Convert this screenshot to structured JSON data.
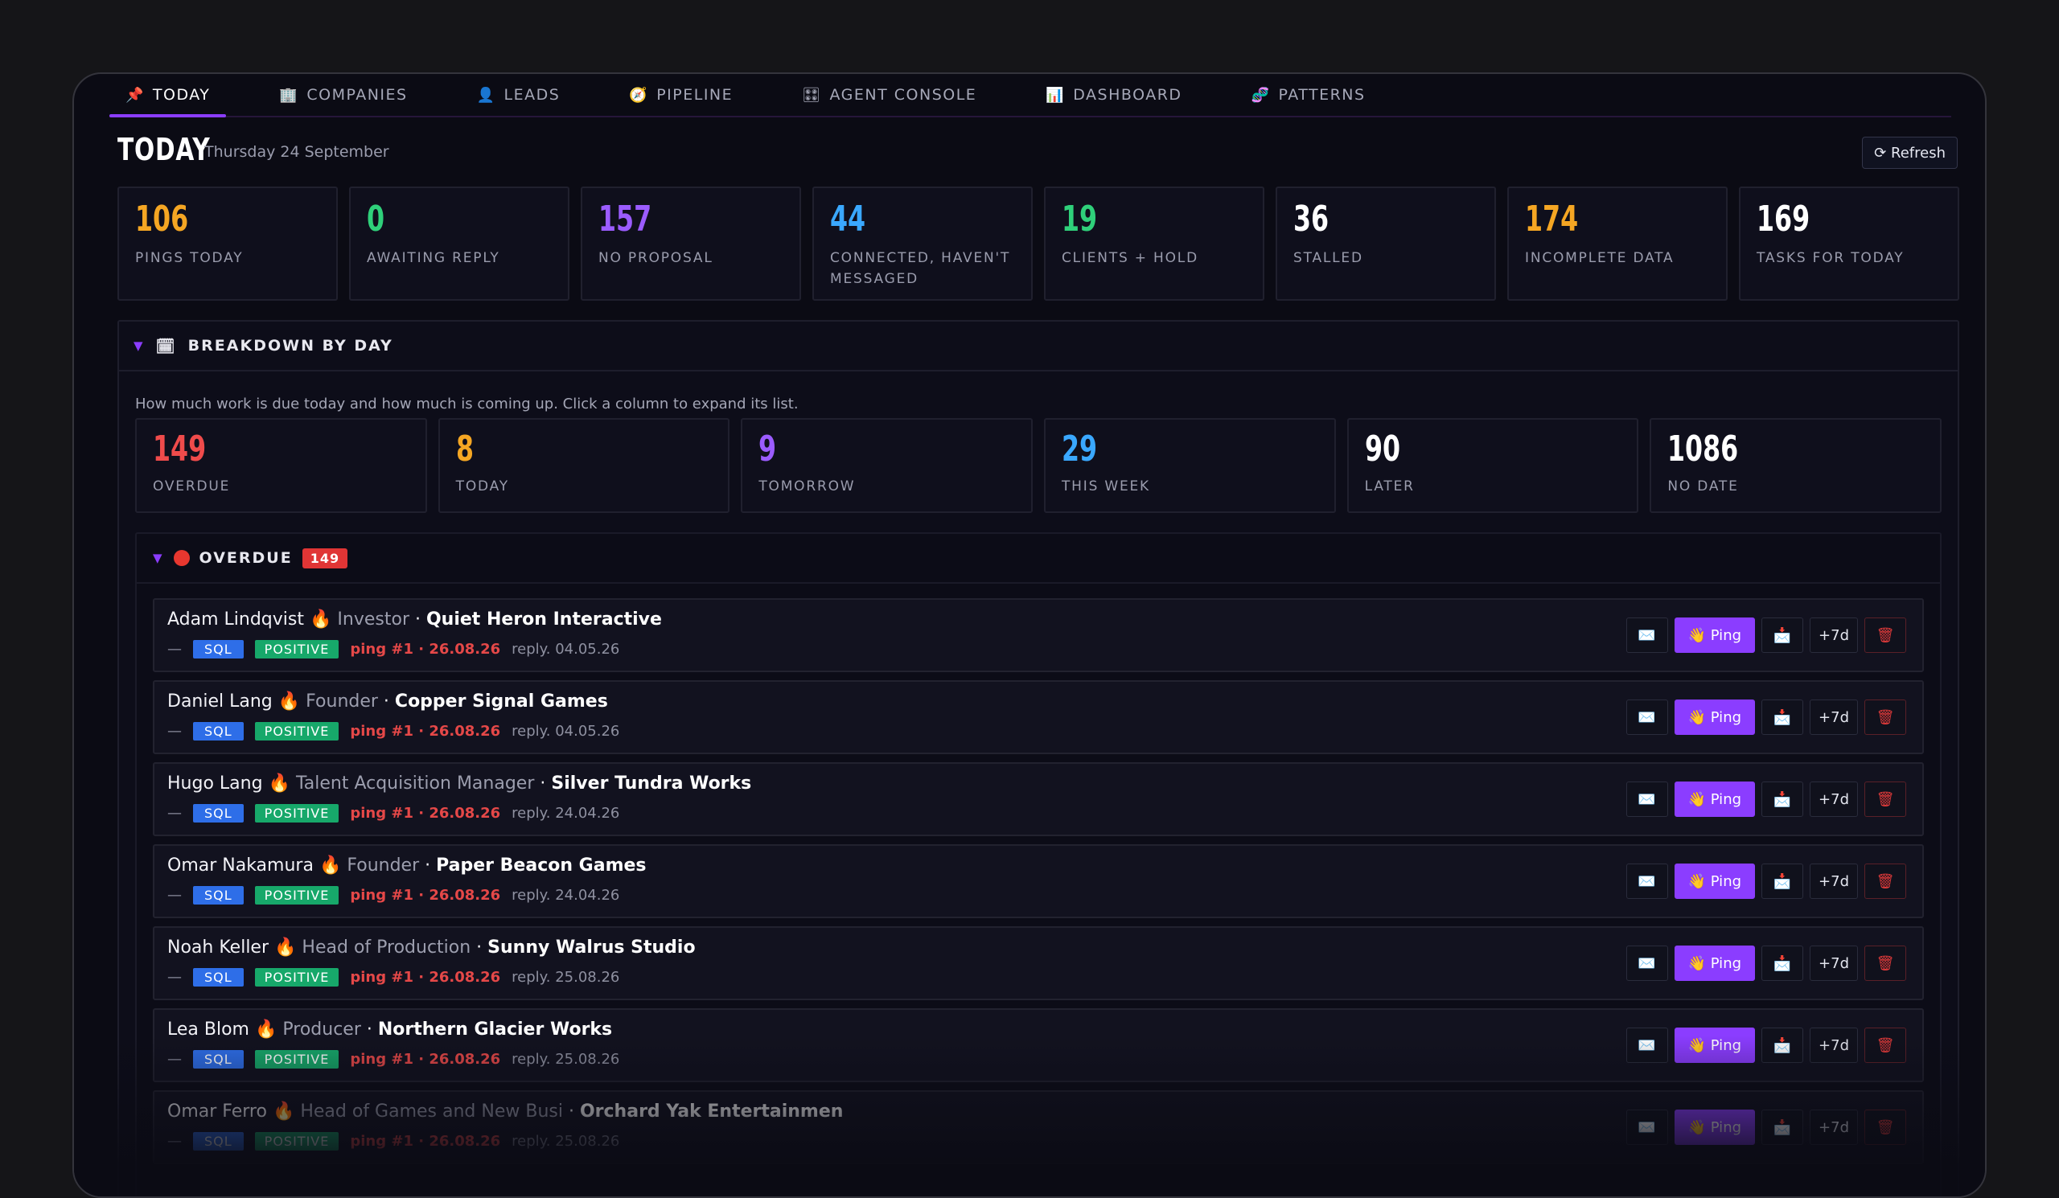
{
  "tabs": [
    {
      "icon": "📌",
      "label": "TODAY"
    },
    {
      "icon": "🏢",
      "label": "COMPANIES"
    },
    {
      "icon": "👤",
      "label": "LEADS"
    },
    {
      "icon": "🧭",
      "label": "PIPELINE"
    },
    {
      "icon": "🎛",
      "label": "AGENT CONSOLE"
    },
    {
      "icon": "📊",
      "label": "DASHBOARD"
    },
    {
      "icon": "🧬",
      "label": "PATTERNS"
    }
  ],
  "header": {
    "title": "TODAY",
    "date": "Thursday 24 September",
    "refresh": "⟳ Refresh"
  },
  "stats": [
    {
      "value": "106",
      "label": "PINGS TODAY",
      "color": "#f5a623"
    },
    {
      "value": "0",
      "label": "AWAITING REPLY",
      "color": "#2fd07a"
    },
    {
      "value": "157",
      "label": "NO PROPOSAL",
      "color": "#9b5cff"
    },
    {
      "value": "44",
      "label": "CONNECTED, HAVEN'T MESSAGED",
      "color": "#3aa8ff"
    },
    {
      "value": "19",
      "label": "CLIENTS + HOLD",
      "color": "#2fd07a"
    },
    {
      "value": "36",
      "label": "STALLED",
      "color": "#ffffff"
    },
    {
      "value": "174",
      "label": "INCOMPLETE DATA",
      "color": "#f5a623"
    },
    {
      "value": "169",
      "label": "TASKS FOR TODAY",
      "color": "#ffffff"
    }
  ],
  "breakdown": {
    "caret": "▼",
    "icon": "🗓",
    "title": "BREAKDOWN BY DAY",
    "description": "How much work is due today and how much is coming up. Click a column to expand its list.",
    "days": [
      {
        "value": "149",
        "label": "OVERDUE",
        "color": "#ef4b4b"
      },
      {
        "value": "8",
        "label": "TODAY",
        "color": "#f5a623"
      },
      {
        "value": "9",
        "label": "TOMORROW",
        "color": "#9b5cff"
      },
      {
        "value": "29",
        "label": "THIS WEEK",
        "color": "#3aa8ff"
      },
      {
        "value": "90",
        "label": "LATER",
        "color": "#ffffff"
      },
      {
        "value": "1086",
        "label": "NO DATE",
        "color": "#ffffff"
      }
    ]
  },
  "overdue": {
    "caret": "▼",
    "title": "OVERDUE",
    "count": "149"
  },
  "row_labels": {
    "dash": "—",
    "sql": "SQL",
    "positive": "POSITIVE",
    "fire": "🔥",
    "mail": "✉️",
    "ping": "👋 Ping",
    "calendar": "📩",
    "plus7": "+7d",
    "trash": "🗑"
  },
  "leads": [
    {
      "name": "Adam Lindqvist",
      "role": "Investor",
      "company": "Quiet Heron Interactive",
      "ping": "ping #1 · 26.08.26",
      "reply": "reply. 04.05.26"
    },
    {
      "name": "Daniel Lang",
      "role": "Founder",
      "company": "Copper Signal Games",
      "ping": "ping #1 · 26.08.26",
      "reply": "reply. 04.05.26"
    },
    {
      "name": "Hugo Lang",
      "role": "Talent Acquisition Manager",
      "company": "Silver Tundra Works",
      "ping": "ping #1 · 26.08.26",
      "reply": "reply. 24.04.26"
    },
    {
      "name": "Omar Nakamura",
      "role": "Founder",
      "company": "Paper Beacon Games",
      "ping": "ping #1 · 26.08.26",
      "reply": "reply. 24.04.26"
    },
    {
      "name": "Noah Keller",
      "role": "Head of Production",
      "company": "Sunny Walrus Studio",
      "ping": "ping #1 · 26.08.26",
      "reply": "reply. 25.08.26"
    },
    {
      "name": "Lea Blom",
      "role": "Producer",
      "company": "Northern Glacier Works",
      "ping": "ping #1 · 26.08.26",
      "reply": "reply. 25.08.26"
    },
    {
      "name": "Omar Ferro",
      "role": "Head of Games and New Busi",
      "company": "Orchard Yak Entertainmen",
      "ping": "ping #1 · 26.08.26",
      "reply": "reply. 25.08.26"
    }
  ]
}
